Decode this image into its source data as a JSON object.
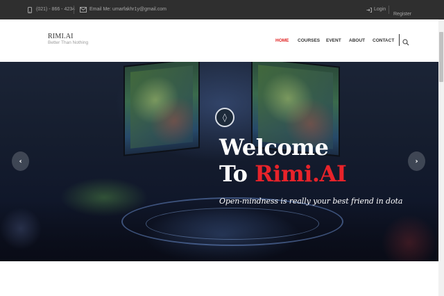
{
  "topbar": {
    "phone": "(021) - 866 - 4234",
    "email": "Email Me: umarfakhr1y@gmail.com",
    "login": "Login",
    "register": "Register",
    "icons": [
      "phone-icon",
      "envelope-icon",
      "login-icon"
    ]
  },
  "brand": {
    "name": "RIMI.AI",
    "tagline": "Better Than Nothing"
  },
  "nav": {
    "items": [
      {
        "label": "HOME",
        "active": true
      },
      {
        "label": "COURSES",
        "active": false
      },
      {
        "label": "EVENT",
        "active": false
      },
      {
        "label": "ABOUT",
        "active": false
      },
      {
        "label": "CONTACT",
        "active": false
      }
    ],
    "search_icon": "search-icon"
  },
  "hero": {
    "title_line1": "Welcome",
    "title_line2_prefix": "To",
    "title_line2_highlight": "Rimi.AI",
    "subtitle": "Open-mindness is really your best friend in dota",
    "prev_label": "‹",
    "next_label": "›",
    "logo_glyph": "◊"
  },
  "colors": {
    "accent": "#e02222",
    "topbar_bg": "#2f2f2f",
    "highlight_text": "#e8232a"
  }
}
